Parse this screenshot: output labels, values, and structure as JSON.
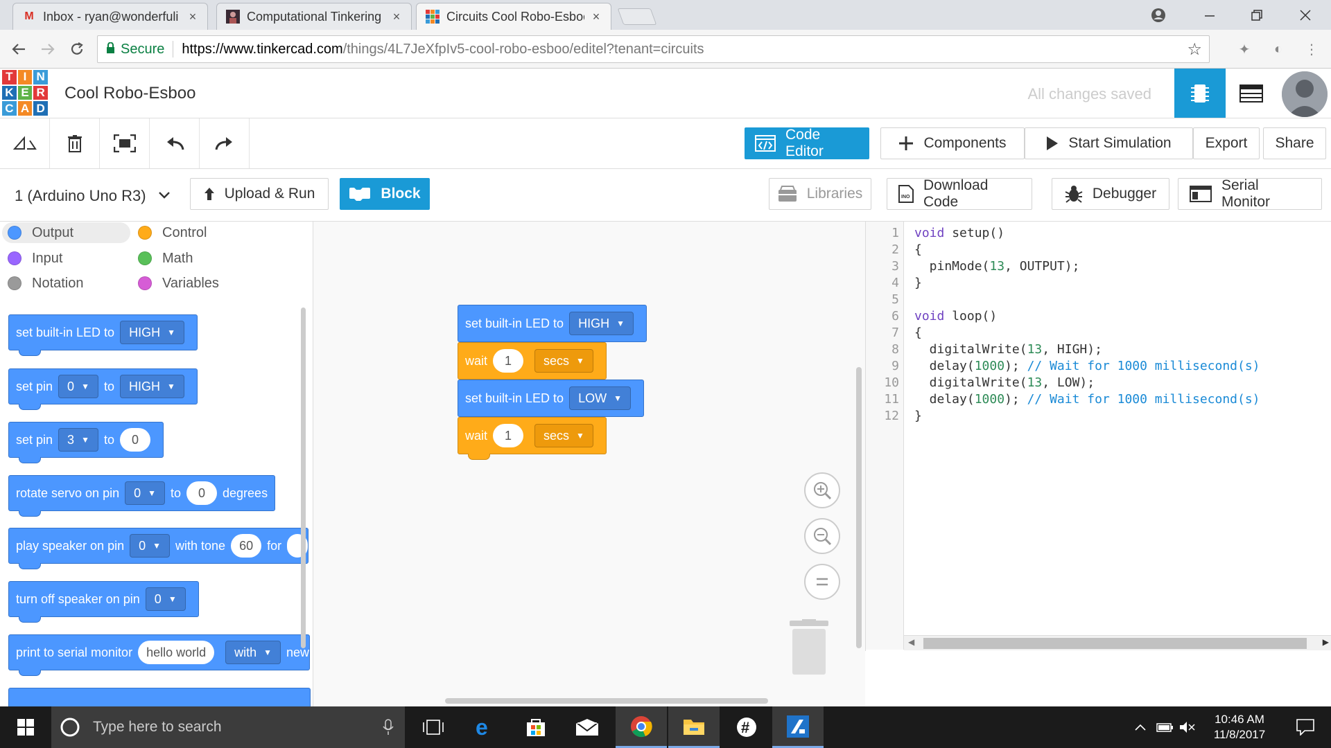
{
  "browser": {
    "tabs": [
      {
        "title": "Inbox - ryan@wonderfuli",
        "close": "×",
        "favicon": "gmail-icon"
      },
      {
        "title": "Computational Tinkering",
        "close": "×",
        "favicon": "profile-icon"
      },
      {
        "title": "Circuits Cool Robo-Esboo",
        "close": "×",
        "favicon": "tinkercad-icon"
      }
    ],
    "address": {
      "secure_label": "Secure",
      "url_host": "https://www.tinkercad.com",
      "url_path": "/things/4L7JeXfpIv5-cool-robo-esboo/editel?tenant=circuits"
    }
  },
  "app": {
    "logo_letters": [
      "T",
      "I",
      "N",
      "K",
      "E",
      "R",
      "C",
      "A",
      "D"
    ],
    "project_title": "Cool Robo-Esboo",
    "save_status": "All changes saved",
    "toolbar": {
      "code_editor": "Code Editor",
      "components": "Components",
      "start_simulation": "Start Simulation",
      "export": "Export",
      "share": "Share"
    },
    "code_toolbar": {
      "board": "1 (Arduino Uno R3)",
      "upload_run": "Upload & Run",
      "block": "Block",
      "libraries": "Libraries",
      "download_code": "Download Code",
      "debugger": "Debugger",
      "serial_monitor": "Serial Monitor"
    },
    "categories": [
      {
        "label": "Output",
        "color": "#4c97ff"
      },
      {
        "label": "Control",
        "color": "#ffab19"
      },
      {
        "label": "Input",
        "color": "#9966ff"
      },
      {
        "label": "Math",
        "color": "#59c059"
      },
      {
        "label": "Notation",
        "color": "#9a9a9a"
      },
      {
        "label": "Variables",
        "color": "#d65cd6"
      }
    ],
    "palette": {
      "b1": {
        "text": "set built-in LED to",
        "dd": "HIGH"
      },
      "b2": {
        "text": "set pin",
        "pin": "0",
        "to": "to",
        "dd": "HIGH"
      },
      "b3": {
        "text": "set pin",
        "pin": "3",
        "to": "to",
        "val": "0"
      },
      "b4": {
        "text": "rotate servo on pin",
        "pin": "0",
        "to": "to",
        "val": "0",
        "unit": "degrees"
      },
      "b5": {
        "text": "play speaker on pin",
        "pin": "0",
        "with": "with tone",
        "val": "60",
        "for": "for"
      },
      "b6": {
        "text": "turn off speaker on pin",
        "pin": "0"
      },
      "b7": {
        "text": "print to serial monitor",
        "val": "hello world",
        "dd": "with",
        "more": "new"
      }
    },
    "workspace": {
      "w1": {
        "text": "set built-in LED to",
        "dd": "HIGH"
      },
      "w2": {
        "text": "wait",
        "val": "1",
        "dd": "secs"
      },
      "w3": {
        "text": "set built-in LED to",
        "dd": "LOW"
      },
      "w4": {
        "text": "wait",
        "val": "1",
        "dd": "secs"
      }
    },
    "zoom": {
      "in": "+",
      "out": "−",
      "reset": "="
    },
    "code": {
      "line_numbers": [
        "1",
        "2",
        "3",
        "4",
        "5",
        "6",
        "7",
        "8",
        "9",
        "10",
        "11",
        "12"
      ],
      "l1a": "void",
      "l1b": " setup()",
      "l2": "{",
      "l3a": "  pinMode(",
      "l3b": "13",
      "l3c": ", OUTPUT);",
      "l4": "}",
      "l6a": "void",
      "l6b": " loop()",
      "l7": "{",
      "l8a": "  digitalWrite(",
      "l8b": "13",
      "l8c": ", HIGH);",
      "l9a": "  delay(",
      "l9b": "1000",
      "l9c": "); ",
      "l9d": "// Wait for 1000 millisecond(s)",
      "l10a": "  digitalWrite(",
      "l10b": "13",
      "l10c": ", LOW);",
      "l11a": "  delay(",
      "l11b": "1000",
      "l11c": "); ",
      "l11d": "// Wait for 1000 millisecond(s)",
      "l12": "}"
    }
  },
  "taskbar": {
    "search_placeholder": "Type here to search",
    "time": "10:46 AM",
    "date": "11/8/2017"
  }
}
